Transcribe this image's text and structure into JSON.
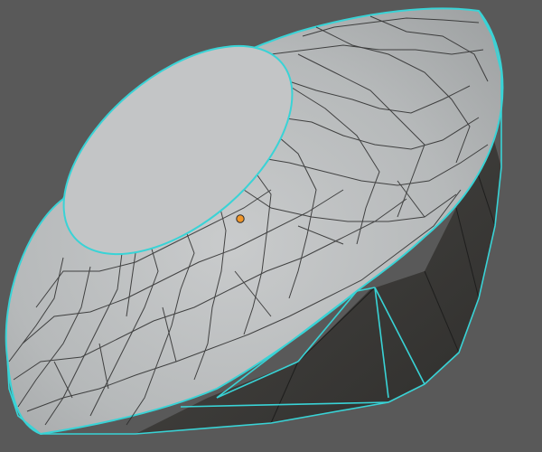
{
  "viewport": {
    "name": "3d-viewport",
    "background": "#595959"
  },
  "mesh": {
    "object": "gem-mesh",
    "crown_color": "#b9bcbd",
    "table_color": "#c1c3c4",
    "pavilion_color": "#3a3937",
    "wire_color": "#2a2a2a",
    "selected_edge_color": "#39d3d6"
  },
  "origin_point": {
    "color": "#f0962a",
    "icon": "object-origin-dot"
  }
}
